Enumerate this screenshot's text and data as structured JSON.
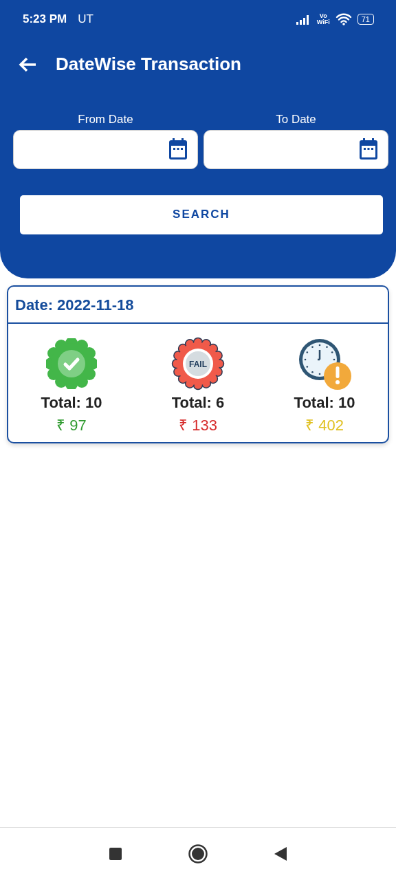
{
  "status_bar": {
    "time": "5:23 PM",
    "carrier": "UT",
    "network_top": "Vo",
    "network_bottom": "WiFi",
    "battery": "71"
  },
  "header": {
    "title": "DateWise Transaction"
  },
  "filters": [
    {
      "label": "From Date"
    },
    {
      "label": "To Date"
    }
  ],
  "search_button": "SEARCH",
  "card": {
    "date": "Date: 2022-11-18",
    "stats": [
      {
        "kind": "success",
        "total": "Total: 10",
        "amount": "₹ 97",
        "color": "#2e9a2e"
      },
      {
        "kind": "fail",
        "badge_text": "FAIL",
        "total": "Total: 6",
        "amount": "₹ 133",
        "color": "#d62b2b"
      },
      {
        "kind": "pending",
        "total": "Total: 10",
        "amount": "₹ 402",
        "color": "#e0c020"
      }
    ]
  }
}
